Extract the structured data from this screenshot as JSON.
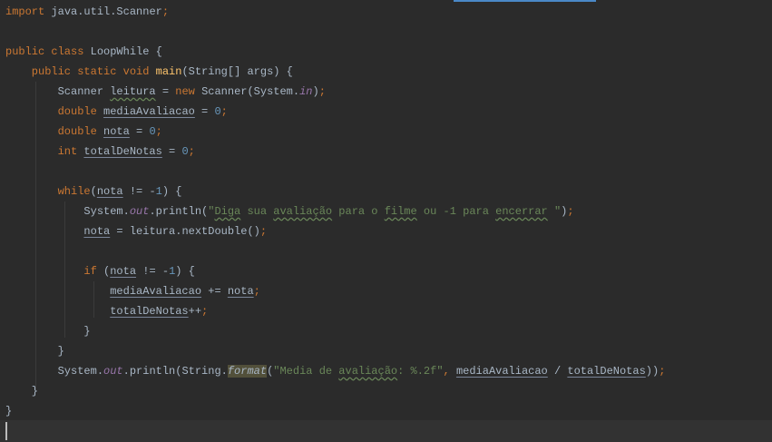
{
  "editor": {
    "accent_color": "#4a88c7",
    "lines": [
      [
        [
          "import",
          "k"
        ],
        [
          " java.util.Scanner",
          "t"
        ],
        [
          ";",
          "k"
        ]
      ],
      [],
      [
        [
          "public class ",
          "k"
        ],
        [
          "LoopWhile {",
          "t"
        ]
      ],
      [
        [
          "    public static void ",
          "k"
        ],
        [
          "main",
          "f"
        ],
        [
          "(String[] args) {",
          "t"
        ]
      ],
      [
        [
          "        Scanner ",
          "t"
        ],
        [
          "leitura",
          "uw"
        ],
        [
          " = ",
          "t"
        ],
        [
          "new ",
          "k"
        ],
        [
          "Scanner(System.",
          "t"
        ],
        [
          "in",
          "i"
        ],
        [
          ")",
          "t"
        ],
        [
          ";",
          "k"
        ]
      ],
      [
        [
          "        double ",
          "k"
        ],
        [
          "mediaAvaliacao",
          "u"
        ],
        [
          " = ",
          "t"
        ],
        [
          "0",
          "n"
        ],
        [
          ";",
          "k"
        ]
      ],
      [
        [
          "        double ",
          "k"
        ],
        [
          "nota",
          "u"
        ],
        [
          " = ",
          "t"
        ],
        [
          "0",
          "n"
        ],
        [
          ";",
          "k"
        ]
      ],
      [
        [
          "        int ",
          "k"
        ],
        [
          "totalDeNotas",
          "u"
        ],
        [
          " = ",
          "t"
        ],
        [
          "0",
          "n"
        ],
        [
          ";",
          "k"
        ]
      ],
      [],
      [
        [
          "        while",
          "k"
        ],
        [
          "(",
          "t"
        ],
        [
          "nota",
          "u"
        ],
        [
          " != -",
          "t"
        ],
        [
          "1",
          "n"
        ],
        [
          ") {",
          "t"
        ]
      ],
      [
        [
          "            System.",
          "t"
        ],
        [
          "out",
          "i"
        ],
        [
          ".println(",
          "t"
        ],
        [
          "\"",
          "s"
        ],
        [
          "Diga",
          "w"
        ],
        [
          " sua ",
          "s"
        ],
        [
          "avaliação",
          "w"
        ],
        [
          " para o ",
          "s"
        ],
        [
          "filme",
          "w"
        ],
        [
          " ou -1 para ",
          "s"
        ],
        [
          "encerrar",
          "w"
        ],
        [
          " \"",
          "s"
        ],
        [
          ")",
          "t"
        ],
        [
          ";",
          "k"
        ]
      ],
      [
        [
          "            ",
          "t"
        ],
        [
          "nota",
          "u"
        ],
        [
          " = leitura.nextDouble()",
          "t"
        ],
        [
          ";",
          "k"
        ]
      ],
      [],
      [
        [
          "            if ",
          "k"
        ],
        [
          "(",
          "t"
        ],
        [
          "nota",
          "u"
        ],
        [
          " != -",
          "t"
        ],
        [
          "1",
          "n"
        ],
        [
          ") {",
          "t"
        ]
      ],
      [
        [
          "                ",
          "t"
        ],
        [
          "mediaAvaliacao",
          "u"
        ],
        [
          " += ",
          "t"
        ],
        [
          "nota",
          "u"
        ],
        [
          ";",
          "k"
        ]
      ],
      [
        [
          "                ",
          "t"
        ],
        [
          "totalDeNotas",
          "u"
        ],
        [
          "++",
          "t"
        ],
        [
          ";",
          "k"
        ]
      ],
      [
        [
          "            }",
          "t"
        ]
      ],
      [
        [
          "        }",
          "t"
        ]
      ],
      [
        [
          "        System.",
          "t"
        ],
        [
          "out",
          "i"
        ],
        [
          ".println(String.",
          "t"
        ],
        [
          "format",
          "h"
        ],
        [
          "(",
          "t"
        ],
        [
          "\"Media de ",
          "s"
        ],
        [
          "avaliação",
          "w"
        ],
        [
          ": %.2f\"",
          "s"
        ],
        [
          ", ",
          "k"
        ],
        [
          "mediaAvaliacao",
          "u"
        ],
        [
          " / ",
          "t"
        ],
        [
          "totalDeNotas",
          "u"
        ],
        [
          "))",
          "t"
        ],
        [
          ";",
          "k"
        ]
      ],
      [
        [
          "    }",
          "t"
        ]
      ],
      [
        [
          "}",
          "t"
        ]
      ]
    ]
  }
}
